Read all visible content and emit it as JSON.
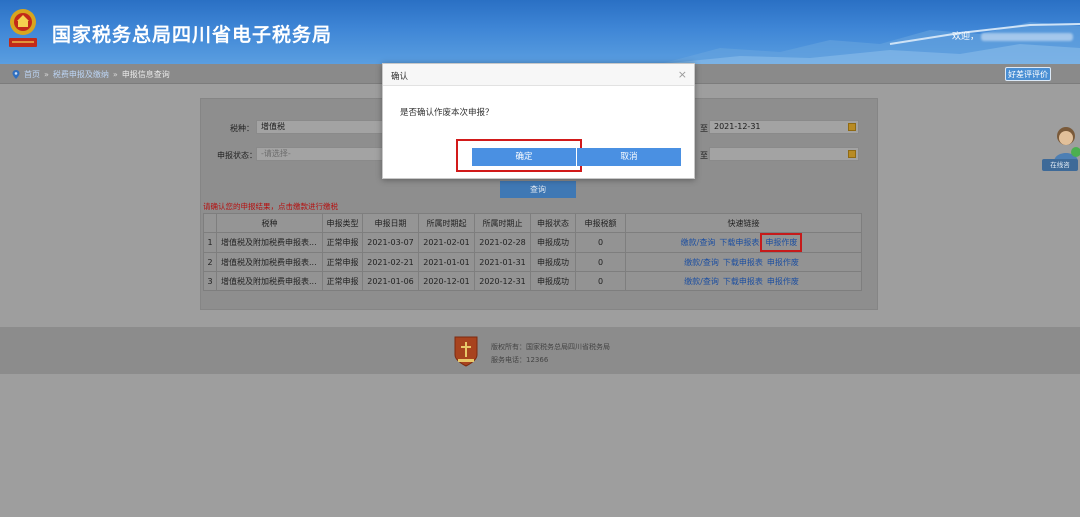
{
  "header": {
    "title": "国家税务总局四川省电子税务局",
    "welcome": "欢迎，"
  },
  "breadcrumb": {
    "home": "首页",
    "sep1": "»",
    "level2": "税费申报及缴纳",
    "sep2": "»",
    "current": "申报信息查询"
  },
  "rate_button": "好差评评价",
  "form": {
    "tax_type_label": "税种：",
    "tax_type_value": "增值税",
    "status_label": "申报状态：",
    "status_placeholder": "-请选择-",
    "date_end_prefix": "至",
    "date_end_value": "2021-12-31",
    "date2_end_prefix": "至",
    "query_button": "查询"
  },
  "notice": "请确认您的申报结果，点击缴款进行缴税",
  "table": {
    "headers": [
      "",
      "税种",
      "申报类型",
      "申报日期",
      "所属时期起",
      "所属时期止",
      "申报状态",
      "申报税额",
      "快速链接"
    ],
    "rows": [
      {
        "idx": "1",
        "tax": "增值税及附加税费申报表...",
        "type": "正常申报",
        "date": "2021-03-07",
        "from": "2021-02-01",
        "to": "2021-02-28",
        "status": "申报成功",
        "amount": "0"
      },
      {
        "idx": "2",
        "tax": "增值税及附加税费申报表...",
        "type": "正常申报",
        "date": "2021-02-21",
        "from": "2021-01-01",
        "to": "2021-01-31",
        "status": "申报成功",
        "amount": "0"
      },
      {
        "idx": "3",
        "tax": "增值税及附加税费申报表...",
        "type": "正常申报",
        "date": "2021-01-06",
        "from": "2020-12-01",
        "to": "2020-12-31",
        "status": "申报成功",
        "amount": "0"
      }
    ],
    "links": {
      "pay": "缴款/查询",
      "download": "下载申报表",
      "void": "申报作废"
    }
  },
  "footer": {
    "copyright": "版权所有：国家税务总局四川省税务局",
    "phone": "服务电话：12366"
  },
  "chat": {
    "label": "在线咨"
  },
  "dialog": {
    "title": "确认",
    "close": "×",
    "message": "是否确认作废本次申报？",
    "ok": "确定",
    "cancel": "取消"
  },
  "colors": {
    "header_blue": "#2a70c4",
    "dialog_button": "#4a90e2",
    "highlight_red": "#d21a1a",
    "notice_red": "#b50f0f",
    "link_blue": "#1d4fa0"
  }
}
